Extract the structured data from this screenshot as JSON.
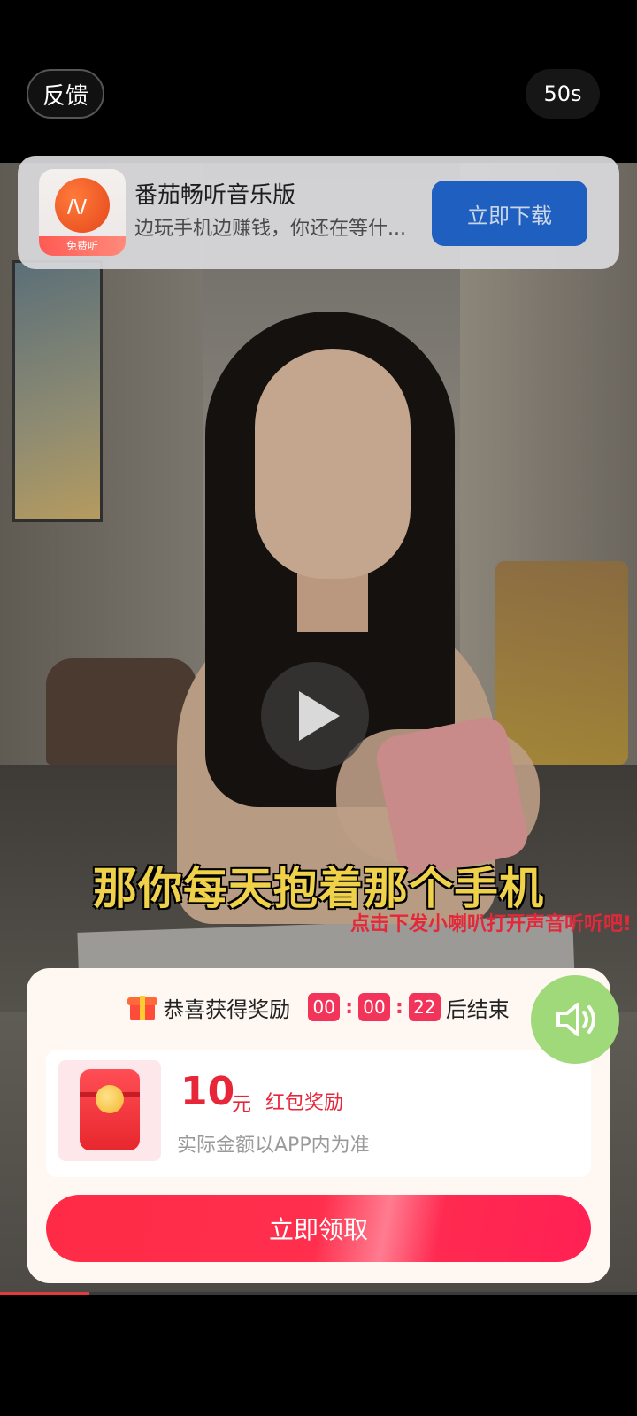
{
  "top": {
    "feedback_label": "反馈",
    "countdown": "50s"
  },
  "ad": {
    "app_name": "番茄畅听音乐版",
    "description": "边玩手机边赚钱，你还在等什...",
    "icon_badge": "免费听",
    "download_label": "立即下载"
  },
  "video": {
    "subtitle": "那你每天抱着那个手机",
    "sound_hint": "点击下发小喇叭打开声音听听吧!",
    "progress_fraction": 0.14
  },
  "reward": {
    "header_prefix": "恭喜获得奖励",
    "timer_hours": "00",
    "timer_minutes": "00",
    "timer_seconds": "22",
    "header_suffix": "后结束",
    "amount": "10",
    "unit": "元",
    "type": "红包奖励",
    "note": "实际金额以APP内为准",
    "claim_label": "立即领取"
  },
  "icons": {
    "gift": "gift-icon",
    "play": "play-icon",
    "sound": "speaker-icon"
  }
}
